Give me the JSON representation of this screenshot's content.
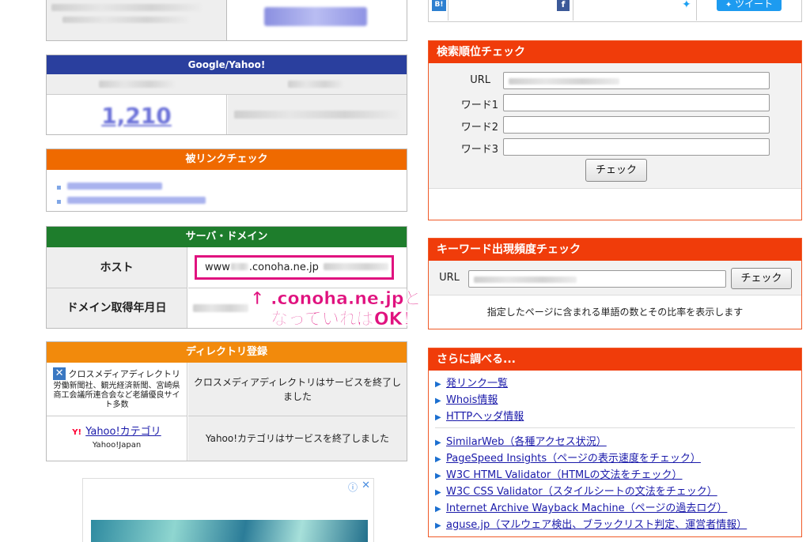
{
  "google_yahoo": {
    "header": "Google/Yahoo!",
    "count": "1,210"
  },
  "backlink": {
    "header": "被リンクチェック"
  },
  "server": {
    "header": "サーバ・ドメイン",
    "host_label": "ホスト",
    "host_prefix": "www",
    "host_domain": ".conoha.ne.jp",
    "domain_date_label": "ドメイン取得年月日"
  },
  "annotation": {
    "line1": "↑ .conoha.ne.jpと",
    "line2": "なっていればOK！"
  },
  "directory": {
    "header": "ディレクトリ登録",
    "rows": [
      {
        "name": "クロスメディアディレクトリ",
        "sub": "労働新聞社、観光経済新聞、宮崎県商工会議所連合会など老舗優良サイト多数",
        "status": "クロスメディアディレクトリはサービスを終了しました"
      },
      {
        "name": "Yahoo!カテゴリ",
        "sub": "Yahoo!Japan",
        "status": "Yahoo!カテゴリはサービスを終了しました"
      }
    ]
  },
  "social": {
    "tweet_label": "ツイート",
    "hatena": "B!",
    "facebook": "f"
  },
  "rank_check": {
    "header": "検索順位チェック",
    "url_label": "URL",
    "word1_label": "ワード1",
    "word2_label": "ワード2",
    "word3_label": "ワード3",
    "button": "チェック"
  },
  "keyword_check": {
    "header": "キーワード出現頻度チェック",
    "url_label": "URL",
    "button": "チェック",
    "description": "指定したページに含まれる単語の数とその比率を表示します"
  },
  "more": {
    "header": "さらに調べる...",
    "group1": [
      "発リンク一覧",
      "Whois情報",
      "HTTPヘッダ情報"
    ],
    "group2": [
      "SimilarWeb（各種アクセス状況）",
      "PageSpeed Insights（ページの表示速度をチェック）",
      "W3C HTML Validator（HTMLの文法をチェック）",
      "W3C CSS Validator（スタイルシートの文法をチェック）",
      "Internet Archive Wayback Machine（ページの過去ログ）",
      "aguse.jp（マルウェア検出、ブラックリスト判定、運営者情報）"
    ]
  },
  "colors": {
    "blue_header": "#2a3f9e",
    "orange_header": "#ef6a00",
    "green_header": "#1e7d2c",
    "directory_header": "#f28a0c",
    "red_header": "#f03c0a",
    "annotation": "#e0127f"
  }
}
